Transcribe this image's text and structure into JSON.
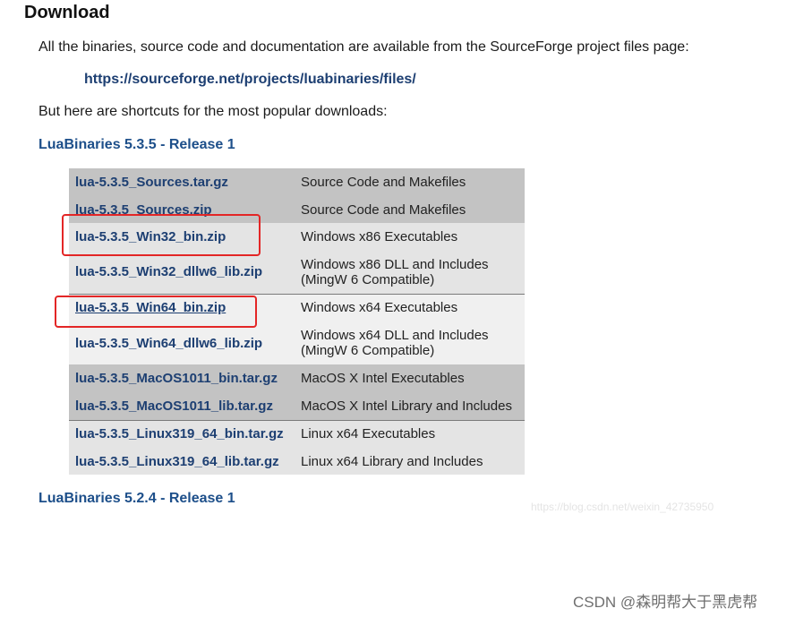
{
  "heading": "Download",
  "intro": "All the binaries, source code and documentation are available from the SourceForge project files page:",
  "sf_link": "https://sourceforge.net/projects/luabinaries/files/",
  "shortcuts_text": "But here are shortcuts for the most popular downloads:",
  "release_535": "LuaBinaries 5.3.5 - Release 1",
  "release_524": "LuaBinaries 5.2.4 - Release 1",
  "files": [
    {
      "name": "lua-5.3.5_Sources.tar.gz",
      "desc": "Source Code and Makefiles"
    },
    {
      "name": "lua-5.3.5_Sources.zip",
      "desc": "Source Code and Makefiles"
    },
    {
      "name": "lua-5.3.5_Win32_bin.zip",
      "desc": "Windows x86 Executables"
    },
    {
      "name": "lua-5.3.5_Win32_dllw6_lib.zip",
      "desc_line1": "Windows x86 DLL and Includes",
      "desc_line2": "(MingW 6 Compatible)"
    },
    {
      "name": "lua-5.3.5_Win64_bin.zip",
      "desc": "Windows x64 Executables"
    },
    {
      "name": "lua-5.3.5_Win64_dllw6_lib.zip",
      "desc_line1": "Windows x64 DLL and Includes",
      "desc_line2": "(MingW 6 Compatible)"
    },
    {
      "name": "lua-5.3.5_MacOS1011_bin.tar.gz",
      "desc": "MacOS X Intel Executables"
    },
    {
      "name": "lua-5.3.5_MacOS1011_lib.tar.gz",
      "desc": "MacOS X Intel Library and Includes"
    },
    {
      "name": "lua-5.3.5_Linux319_64_bin.tar.gz",
      "desc": "Linux x64 Executables"
    },
    {
      "name": "lua-5.3.5_Linux319_64_lib.tar.gz",
      "desc": "Linux x64 Library and Includes"
    }
  ],
  "watermark_url": "https://blog.csdn.net/weixin_42735950",
  "watermark_csdn": "CSDN @森明帮大于黑虎帮",
  "colors": {
    "link": "#1d3f72",
    "highlight": "#e32626"
  }
}
